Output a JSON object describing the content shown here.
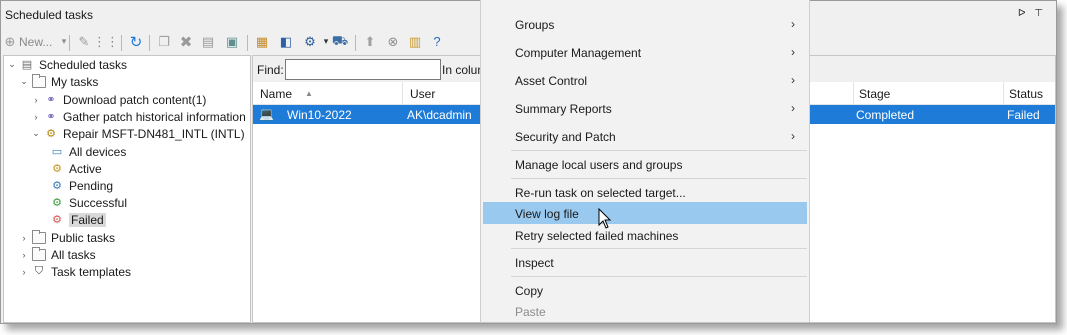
{
  "panel": {
    "title": "Scheduled tasks",
    "pin_icons": "ᐅ ⊤"
  },
  "toolbar": {
    "new_label": "New..."
  },
  "tree": {
    "root": "Scheduled tasks",
    "my_tasks": "My tasks",
    "items": {
      "download": "Download patch content(1)",
      "gather": "Gather patch historical information",
      "repair": "Repair MSFT-DN481_INTL (INTL)",
      "all_devices": "All devices",
      "active": "Active",
      "pending": "Pending",
      "successful": "Successful",
      "failed": "Failed"
    },
    "public_tasks": "Public tasks",
    "all_tasks": "All tasks",
    "task_templates": "Task templates"
  },
  "find": {
    "label": "Find:",
    "value": "",
    "in_column": "In colum"
  },
  "table": {
    "headers": {
      "name": "Name",
      "user": "User",
      "stage": "Stage",
      "status": "Status"
    },
    "row": {
      "name": "Win10-2022",
      "user": "AK\\dcadmin",
      "stage": "Completed",
      "status": "Failed"
    }
  },
  "menu": {
    "items": [
      "Groups",
      "Computer Management",
      "Asset Control",
      "Summary Reports",
      "Security and Patch",
      "Manage local users and groups",
      "Re-run task on selected target...",
      "View log file",
      "Retry selected failed machines",
      "Inspect",
      "Copy",
      "Paste"
    ]
  },
  "colors": {
    "selection": "#1e7bd7",
    "menu_highlight": "#99c9ef",
    "failed": "#d9534f"
  }
}
